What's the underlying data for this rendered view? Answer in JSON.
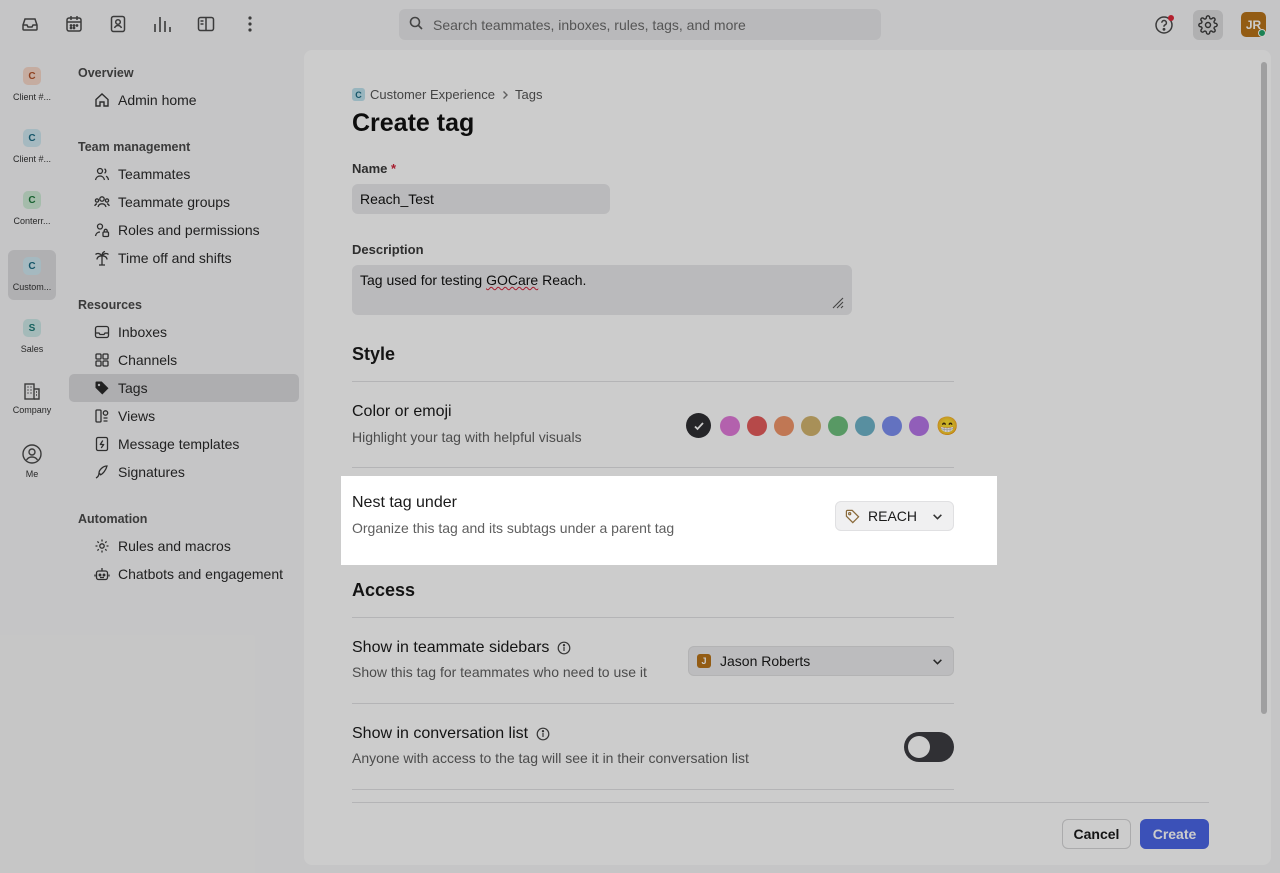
{
  "topbar": {
    "icons": [
      "inbox-icon",
      "calendar-icon",
      "contacts-icon",
      "analytics-icon",
      "split-view-icon",
      "more-icon"
    ],
    "search_placeholder": "Search teammates, inboxes, rules, tags, and more",
    "user_initials": "JR",
    "colors": {
      "avatar": "#b8741a",
      "notification_dot": "#e0293a",
      "status_online": "#22a36a"
    }
  },
  "workspaces": [
    {
      "initial": "C",
      "label": "Client #...",
      "color": "#f7d7c9",
      "text_color": "#b3532a",
      "active": false
    },
    {
      "initial": "C",
      "label": "Client #...",
      "color": "#cfe8f0",
      "text_color": "#1b6b84",
      "active": false
    },
    {
      "initial": "C",
      "label": "Conterr...",
      "color": "#cfecd6",
      "text_color": "#1f7a3d",
      "active": false
    },
    {
      "initial": "C",
      "label": "Custom...",
      "color": "#cfe8f0",
      "text_color": "#1b6b84",
      "active": true
    },
    {
      "initial": "S",
      "label": "Sales",
      "color": "#cde9e8",
      "text_color": "#1c7a76",
      "active": false
    }
  ],
  "rail_bottom": {
    "company_label": "Company",
    "me_label": "Me"
  },
  "nav": {
    "overview": {
      "heading": "Overview",
      "items": [
        "Admin home"
      ]
    },
    "team": {
      "heading": "Team management",
      "items": [
        "Teammates",
        "Teammate groups",
        "Roles and permissions",
        "Time off and shifts"
      ]
    },
    "resources": {
      "heading": "Resources",
      "items": [
        "Inboxes",
        "Channels",
        "Tags",
        "Views",
        "Message templates",
        "Signatures"
      ],
      "active": "Tags"
    },
    "automation": {
      "heading": "Automation",
      "items": [
        "Rules and macros",
        "Chatbots and engagement"
      ]
    }
  },
  "form": {
    "breadcrumb": {
      "workspace_initial": "C",
      "workspace": "Customer Experience",
      "page": "Tags"
    },
    "title": "Create tag",
    "name_label": "Name",
    "name_required_mark": "*",
    "name_value": "Reach_Test",
    "description_label": "Description",
    "description_value_prefix": "Tag used for testing ",
    "description_value_flagged": "GOCare",
    "description_value_suffix": " Reach.",
    "style_heading": "Style",
    "color_title": "Color or emoji",
    "color_sub": "Highlight your tag with helpful visuals",
    "swatch_colors": [
      "#2f2f33",
      "#e07ad9",
      "#e45c5c",
      "#f0956a",
      "#d3b46e",
      "#6fc07e",
      "#6fb3c9",
      "#7c8ff0",
      "#b676e8"
    ],
    "emoji": "😁",
    "nest_title": "Nest tag under",
    "nest_sub": "Organize this tag and its subtags under a parent tag",
    "nest_value": "REACH",
    "access_heading": "Access",
    "sidebar_title": "Show in teammate sidebars",
    "sidebar_sub": "Show this tag for teammates who need to use it",
    "sidebar_user_initial": "J",
    "sidebar_user": "Jason Roberts",
    "convlist_title": "Show in conversation list",
    "convlist_sub": "Anyone with access to the tag will see it in their conversation list",
    "convlist_enabled": false
  },
  "footer": {
    "cancel_label": "Cancel",
    "create_label": "Create",
    "accent": "#4a66e6"
  }
}
